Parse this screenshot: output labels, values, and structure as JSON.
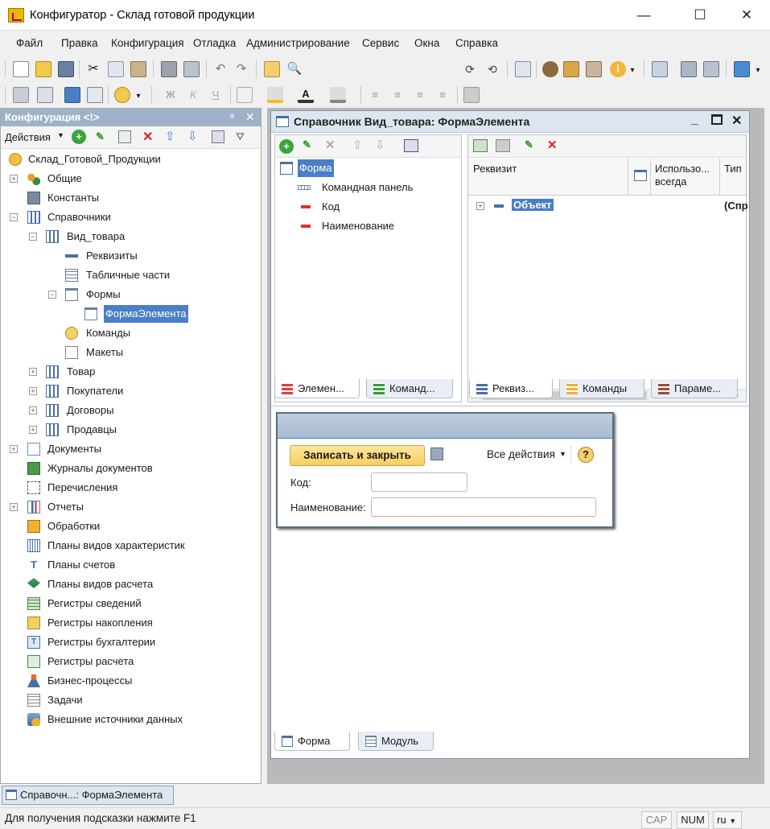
{
  "window": {
    "title": "Конфигуратор - Склад готовой продукции",
    "minimize": "—",
    "maximize": "☐",
    "close": "✕"
  },
  "menu": {
    "items": [
      "Файл",
      "Правка",
      "Конфигурация",
      "Отладка",
      "Администрирование",
      "Сервис",
      "Окна",
      "Справка"
    ]
  },
  "config_panel": {
    "title": "Конфигурация <!>",
    "actions_label": "Действия",
    "pin": "ᵠ",
    "close": "✕",
    "tree": [
      {
        "label": "Склад_Готовой_Продукции",
        "icon": "config-root-icon"
      },
      {
        "label": "Общие",
        "icon": "common-icon",
        "expander": "+"
      },
      {
        "label": "Константы",
        "icon": "constants-icon"
      },
      {
        "label": "Справочники",
        "icon": "catalogs-icon",
        "expander": "−"
      },
      {
        "label": "Вид_товара",
        "icon": "catalog-icon",
        "expander": "−"
      },
      {
        "label": "Реквизиты",
        "icon": "attributes-icon"
      },
      {
        "label": "Табличные части",
        "icon": "tabular-section-icon"
      },
      {
        "label": "Формы",
        "icon": "forms-icon",
        "expander": "−"
      },
      {
        "label": "ФормаЭлемента",
        "icon": "form-icon"
      },
      {
        "label": "Команды",
        "icon": "commands-icon"
      },
      {
        "label": "Макеты",
        "icon": "templates-icon"
      },
      {
        "label": "Товар",
        "icon": "catalog-icon",
        "expander": "+"
      },
      {
        "label": "Покупатели",
        "icon": "catalog-icon",
        "expander": "+"
      },
      {
        "label": "Договоры",
        "icon": "catalog-icon",
        "expander": "+"
      },
      {
        "label": "Продавцы",
        "icon": "catalog-icon",
        "expander": "+"
      },
      {
        "label": "Документы",
        "icon": "documents-icon",
        "expander": "+"
      },
      {
        "label": "Журналы документов",
        "icon": "document-journals-icon"
      },
      {
        "label": "Перечисления",
        "icon": "enumerations-icon"
      },
      {
        "label": "Отчеты",
        "icon": "reports-icon",
        "expander": "+"
      },
      {
        "label": "Обработки",
        "icon": "data-processors-icon"
      },
      {
        "label": "Планы видов характеристик",
        "icon": "chart-of-characteristics-icon"
      },
      {
        "label": "Планы счетов",
        "icon": "chart-of-accounts-icon"
      },
      {
        "label": "Планы видов расчета",
        "icon": "chart-of-calculation-icon"
      },
      {
        "label": "Регистры сведений",
        "icon": "information-registers-icon"
      },
      {
        "label": "Регистры накопления",
        "icon": "accumulation-registers-icon"
      },
      {
        "label": "Регистры бухгалтерии",
        "icon": "accounting-registers-icon"
      },
      {
        "label": "Регистры расчета",
        "icon": "calculation-registers-icon"
      },
      {
        "label": "Бизнес-процессы",
        "icon": "business-processes-icon"
      },
      {
        "label": "Задачи",
        "icon": "tasks-icon"
      },
      {
        "label": "Внешние источники данных",
        "icon": "external-data-sources-icon"
      }
    ]
  },
  "form_editor": {
    "title": "Справочник Вид_товара: ФормаЭлемента",
    "elements": {
      "items": [
        "Форма",
        "Командная панель",
        "Код",
        "Наименование"
      ]
    },
    "attributes": {
      "col_requisite": "Реквизит",
      "col_use_always": "Использо... всегда",
      "col_type": "Тип",
      "row_name": "Объект",
      "row_type": "(Спр"
    },
    "left_tabs": [
      "Элемен...",
      "Команд..."
    ],
    "right_tabs": [
      "Реквиз...",
      "Команды",
      "Параме..."
    ],
    "bottom_tabs": [
      "Форма",
      "Модуль"
    ]
  },
  "preview": {
    "save_close": "Записать и закрыть",
    "all_actions": "Все действия",
    "help": "?",
    "code_label": "Код:",
    "name_label": "Наименование:"
  },
  "taskbar": {
    "item": "Справочн...: ФормаЭлемента"
  },
  "status": {
    "hint": "Для получения подсказки нажмите F1",
    "cap": "CAP",
    "num": "NUM",
    "lang": "ru"
  }
}
